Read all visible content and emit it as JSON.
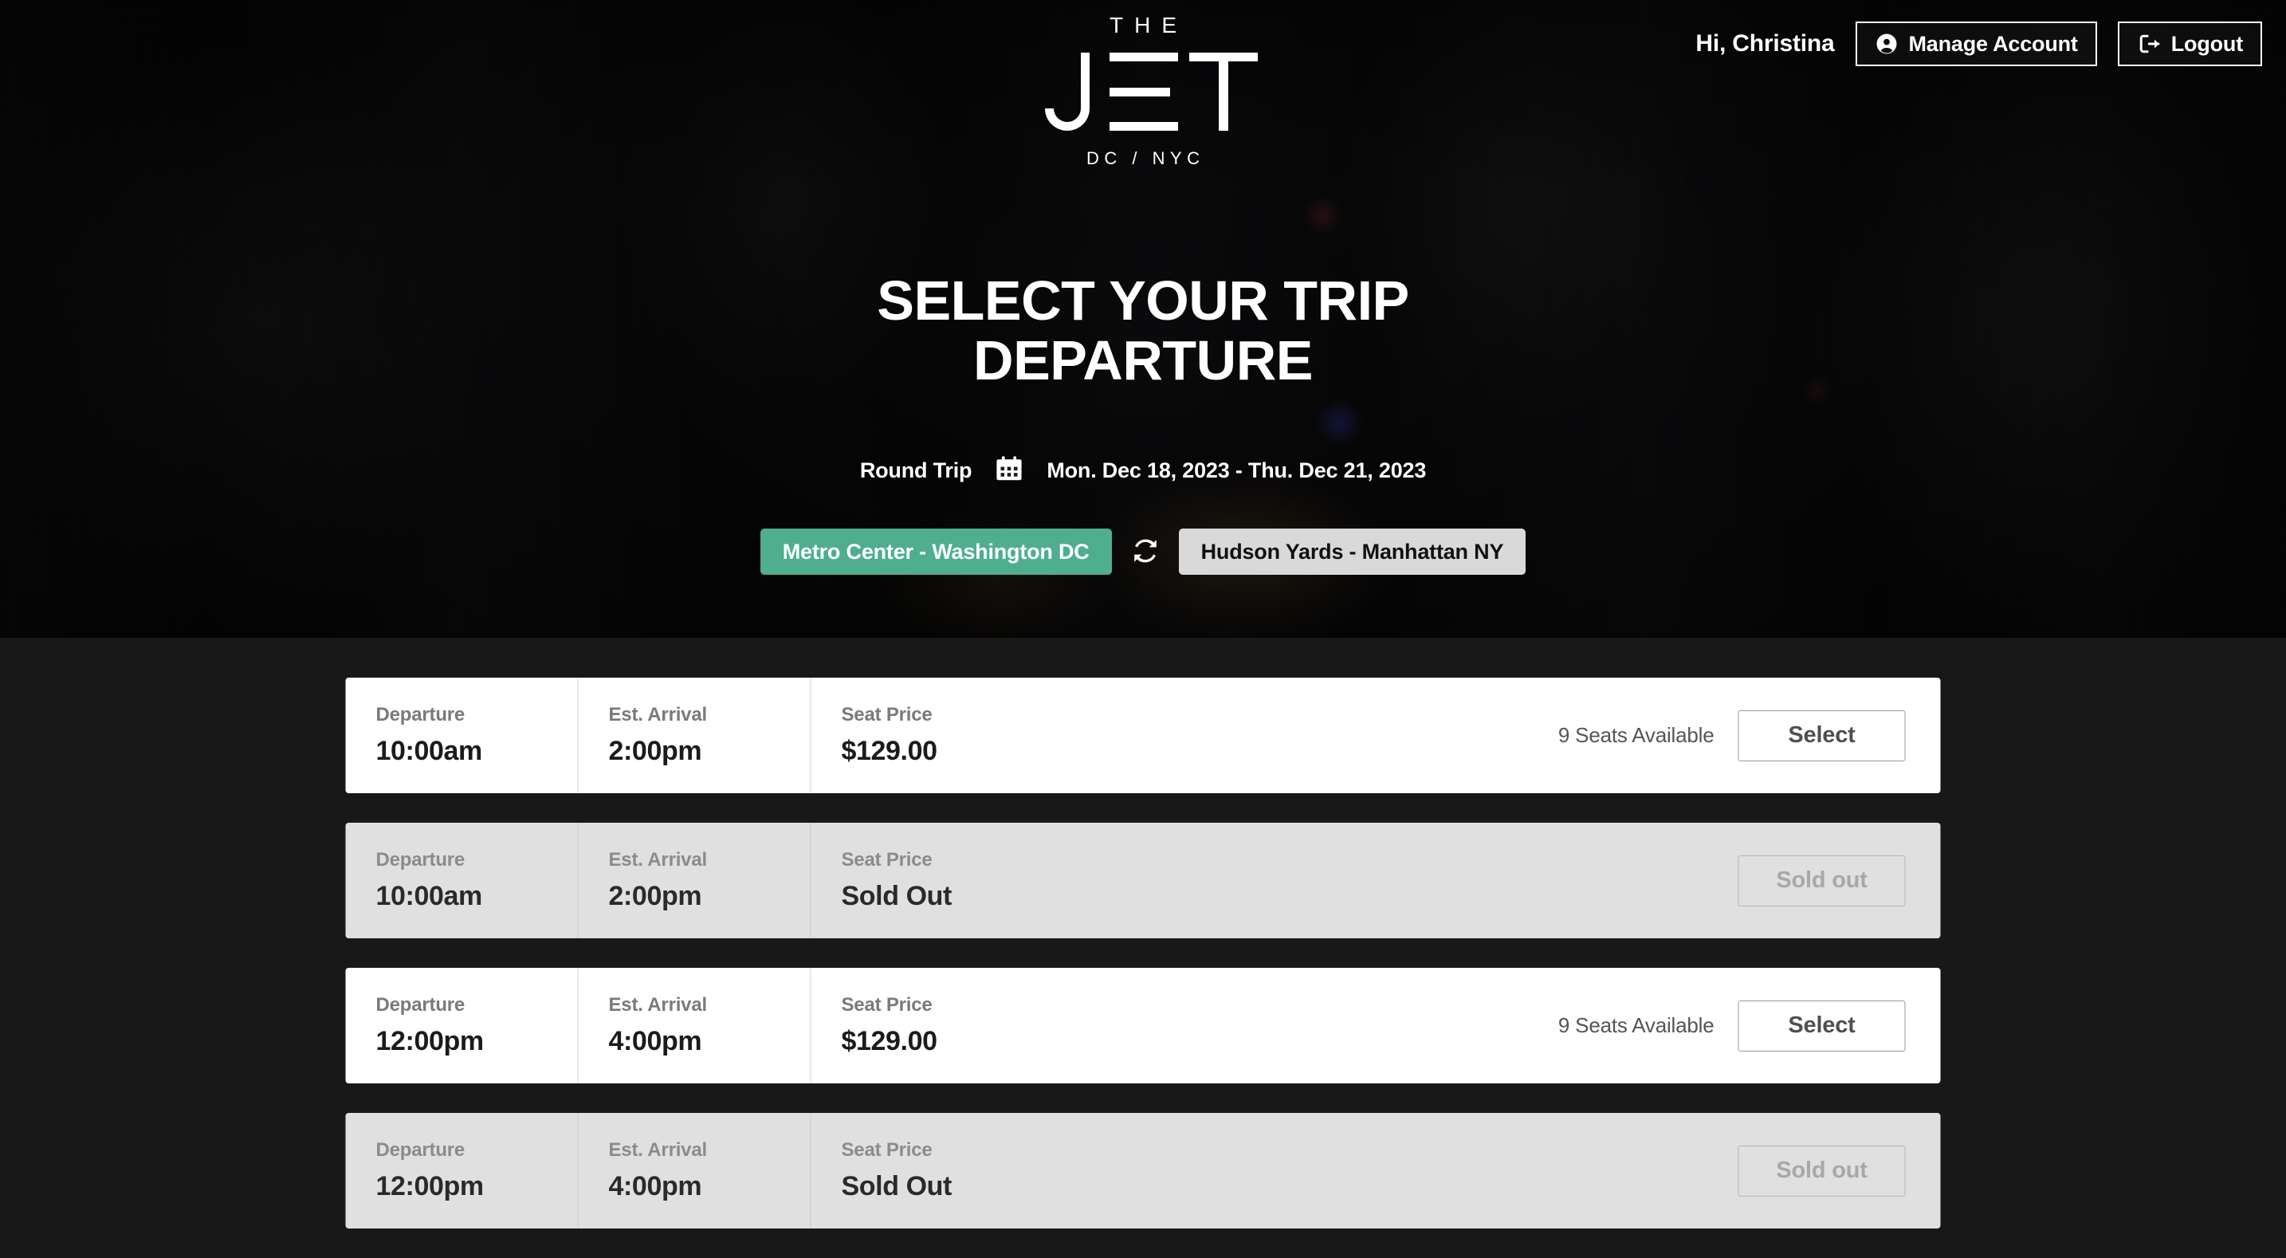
{
  "header": {
    "greeting": "Hi, Christina",
    "manage_account_label": "Manage Account",
    "logout_label": "Logout"
  },
  "logo": {
    "the": "THE",
    "mark": "JET",
    "sub": "DC / NYC"
  },
  "hero": {
    "headline": "Select Your Trip Departure",
    "trip_type": "Round Trip",
    "dates": "Mon. Dec 18, 2023 - Thu. Dec 21, 2023",
    "origin": "Metro Center - Washington DC",
    "destination": "Hudson Yards - Manhattan NY"
  },
  "labels": {
    "departure": "Departure",
    "arrival": "Est. Arrival",
    "price": "Seat Price"
  },
  "colors": {
    "accent_green": "#4fae8d",
    "destination_pill": "#d9d9d9",
    "page_background": "#181818",
    "row_available": "#ffffff",
    "row_soldout": "#e0e0e0"
  },
  "trips": [
    {
      "departure": "10:00am",
      "arrival": "2:00pm",
      "price": "$129.00",
      "seats": "9 Seats Available",
      "action": "Select",
      "sold_out": false
    },
    {
      "departure": "10:00am",
      "arrival": "2:00pm",
      "price": "Sold Out",
      "seats": "",
      "action": "Sold out",
      "sold_out": true
    },
    {
      "departure": "12:00pm",
      "arrival": "4:00pm",
      "price": "$129.00",
      "seats": "9 Seats Available",
      "action": "Select",
      "sold_out": false
    },
    {
      "departure": "12:00pm",
      "arrival": "4:00pm",
      "price": "Sold Out",
      "seats": "",
      "action": "Sold out",
      "sold_out": true
    }
  ]
}
